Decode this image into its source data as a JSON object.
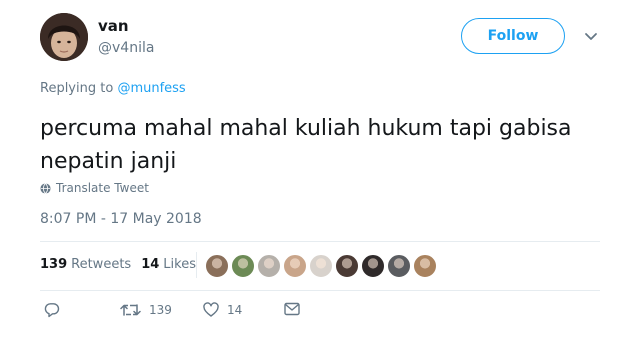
{
  "author": {
    "display_name": "van",
    "handle": "@v4nila",
    "avatar_icon": "avatar-photo"
  },
  "follow_label": "Follow",
  "reply_context": {
    "prefix": "Replying to",
    "mention": "@munfess"
  },
  "tweet_text": "percuma mahal mahal kuliah hukum tapi gabisa nepatin janji",
  "translate_label": "Translate Tweet",
  "timestamp": "8:07 PM - 17 May 2018",
  "stats": {
    "retweets_count": "139",
    "retweets_label": "Retweets",
    "likes_count": "14",
    "likes_label": "Likes"
  },
  "likers": [
    {
      "name": "liker-avatar-1",
      "color": "#8a6f5a"
    },
    {
      "name": "liker-avatar-2",
      "color": "#6c8a55"
    },
    {
      "name": "liker-avatar-3",
      "color": "#b5b0aa"
    },
    {
      "name": "liker-avatar-4",
      "color": "#c9a58a"
    },
    {
      "name": "liker-avatar-5",
      "color": "#d8d2cc"
    },
    {
      "name": "liker-avatar-6",
      "color": "#4a3a34"
    },
    {
      "name": "liker-avatar-7",
      "color": "#2f2a2a"
    },
    {
      "name": "liker-avatar-8",
      "color": "#5a5c60"
    },
    {
      "name": "liker-avatar-9",
      "color": "#a9825e"
    }
  ],
  "actions": {
    "reply_icon": "reply-icon",
    "retweet_icon": "retweet-icon",
    "retweet_count": "139",
    "like_icon": "heart-icon",
    "like_count": "14",
    "dm_icon": "envelope-icon"
  },
  "colors": {
    "accent": "#1da1f2",
    "text": "#14171a",
    "secondary_text": "#657786",
    "divider": "#e6ecf0"
  }
}
